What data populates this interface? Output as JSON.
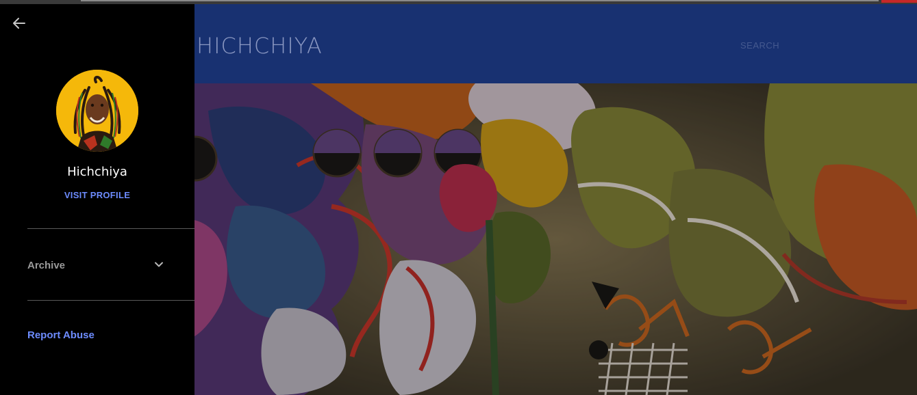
{
  "blog": {
    "title": "HICHCHIYA",
    "search_label": "SEARCH"
  },
  "drawer": {
    "back_icon": "arrow-left-icon",
    "profile_name": "Hichchiya",
    "visit_profile": "VISIT PROFILE",
    "archive_label": "Archive",
    "archive_icon": "chevron-down-icon",
    "report_abuse": "Report Abuse"
  },
  "colors": {
    "header_bg": "#183171",
    "drawer_bg": "#000000",
    "link": "#6d8cff",
    "avatar_bg": "#f5b80a"
  }
}
